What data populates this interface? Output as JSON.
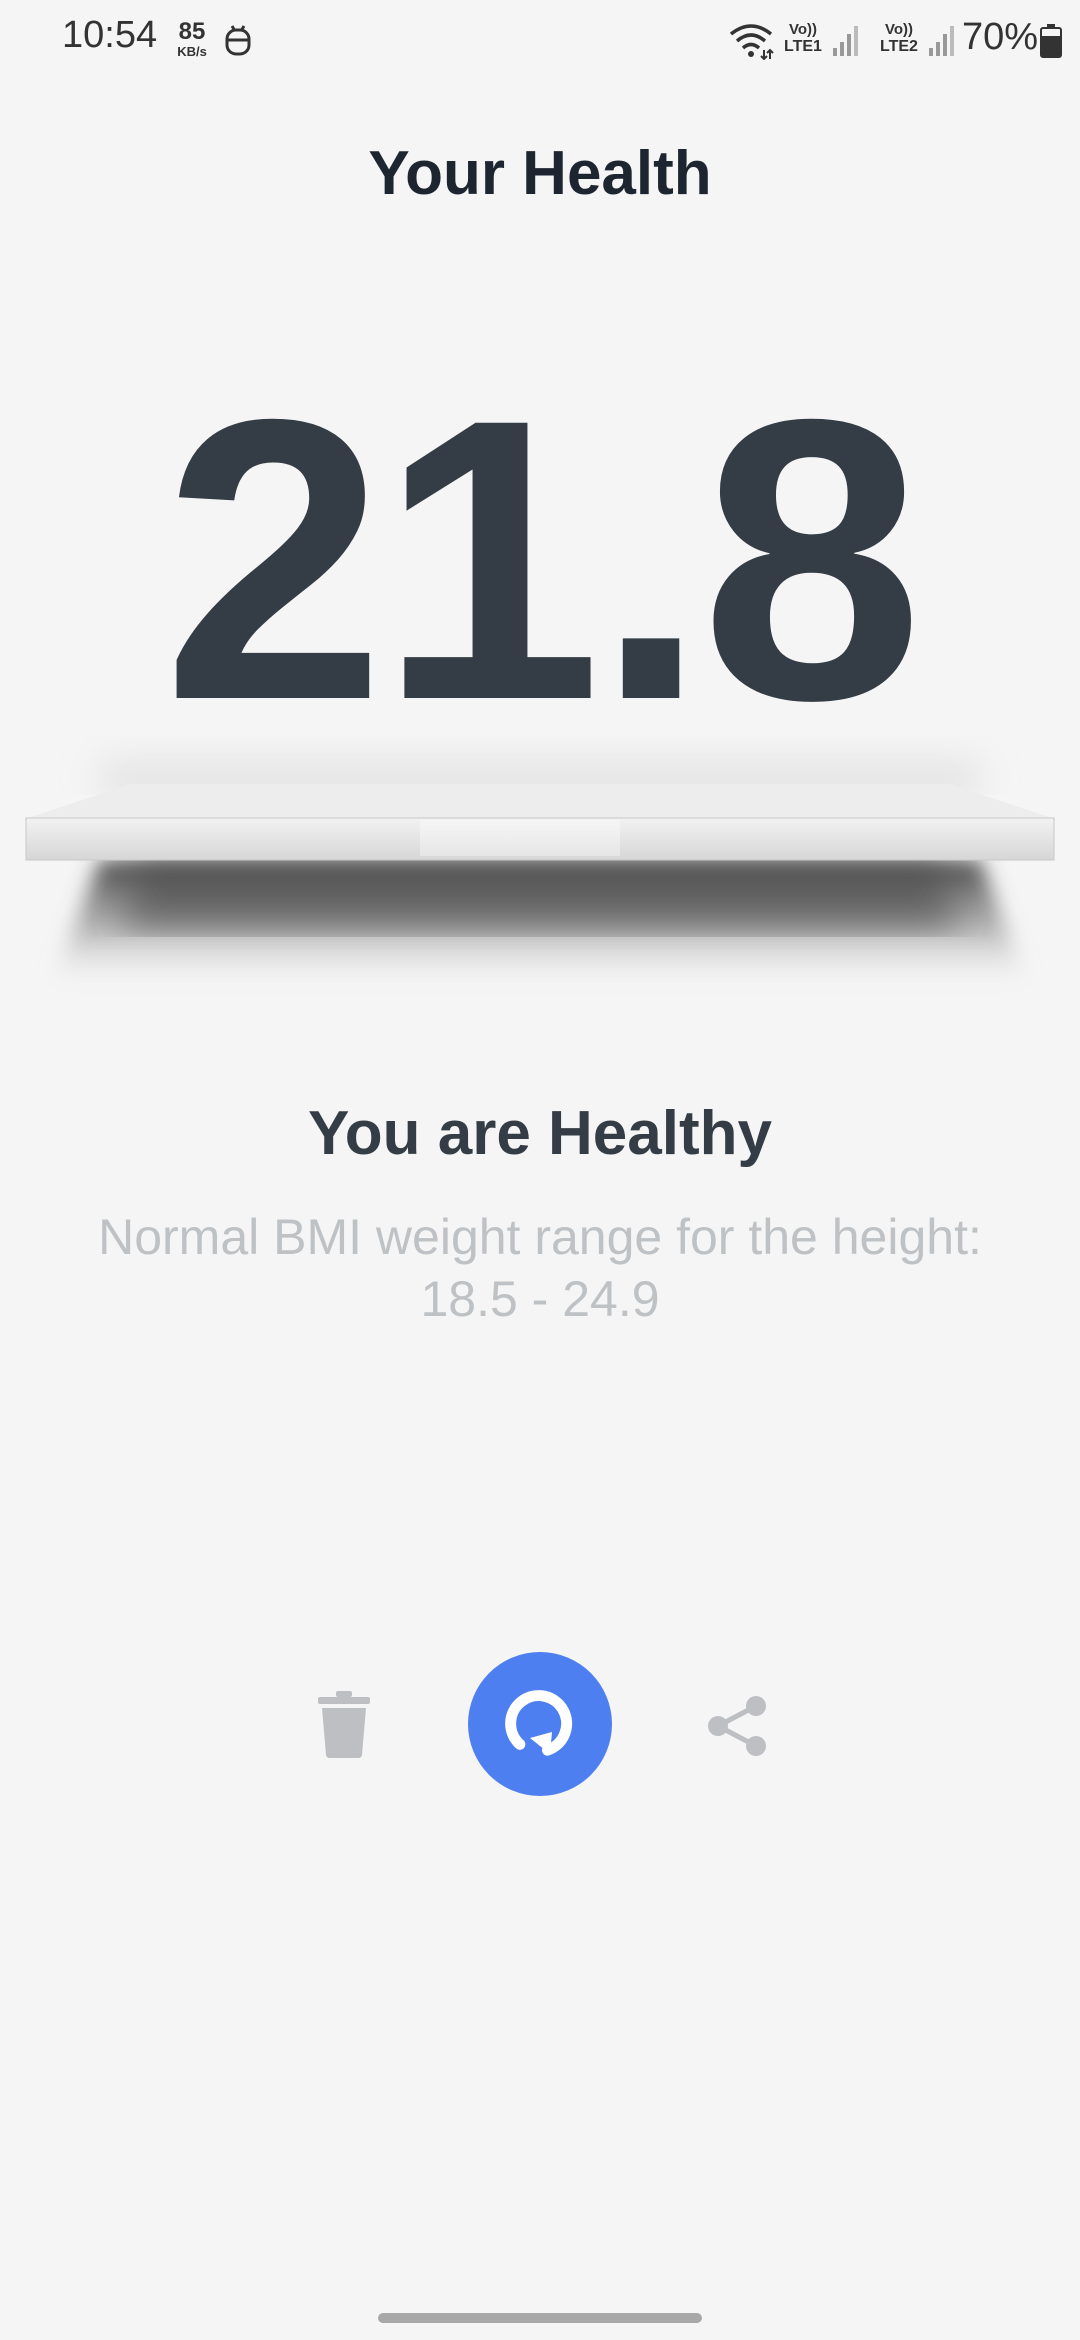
{
  "status_bar": {
    "time": "10:54",
    "net_speed_value": "85",
    "net_speed_unit": "KB/s",
    "sim1_volte": "Vo))",
    "sim1_label": "LTE1",
    "sim2_volte": "Vo))",
    "sim2_label": "LTE2",
    "battery_percent": "70%",
    "icons": [
      "app-notification-icon",
      "wifi-icon",
      "signal-icon",
      "battery-icon"
    ]
  },
  "header": {
    "title": "Your Health"
  },
  "bmi": {
    "value": "21.8"
  },
  "result": {
    "title": "You are Healthy",
    "description": "Normal BMI weight range for the height: 18.5 - 24.9"
  },
  "actions": {
    "delete_icon": "trash-icon",
    "recalculate_icon": "refresh-icon",
    "share_icon": "share-icon"
  },
  "colors": {
    "background": "#f5f5f5",
    "primary_text": "#343d45",
    "secondary_text": "#bfc2c5",
    "accent": "#4e7ff0",
    "inactive_icon": "#bdbfc2"
  }
}
